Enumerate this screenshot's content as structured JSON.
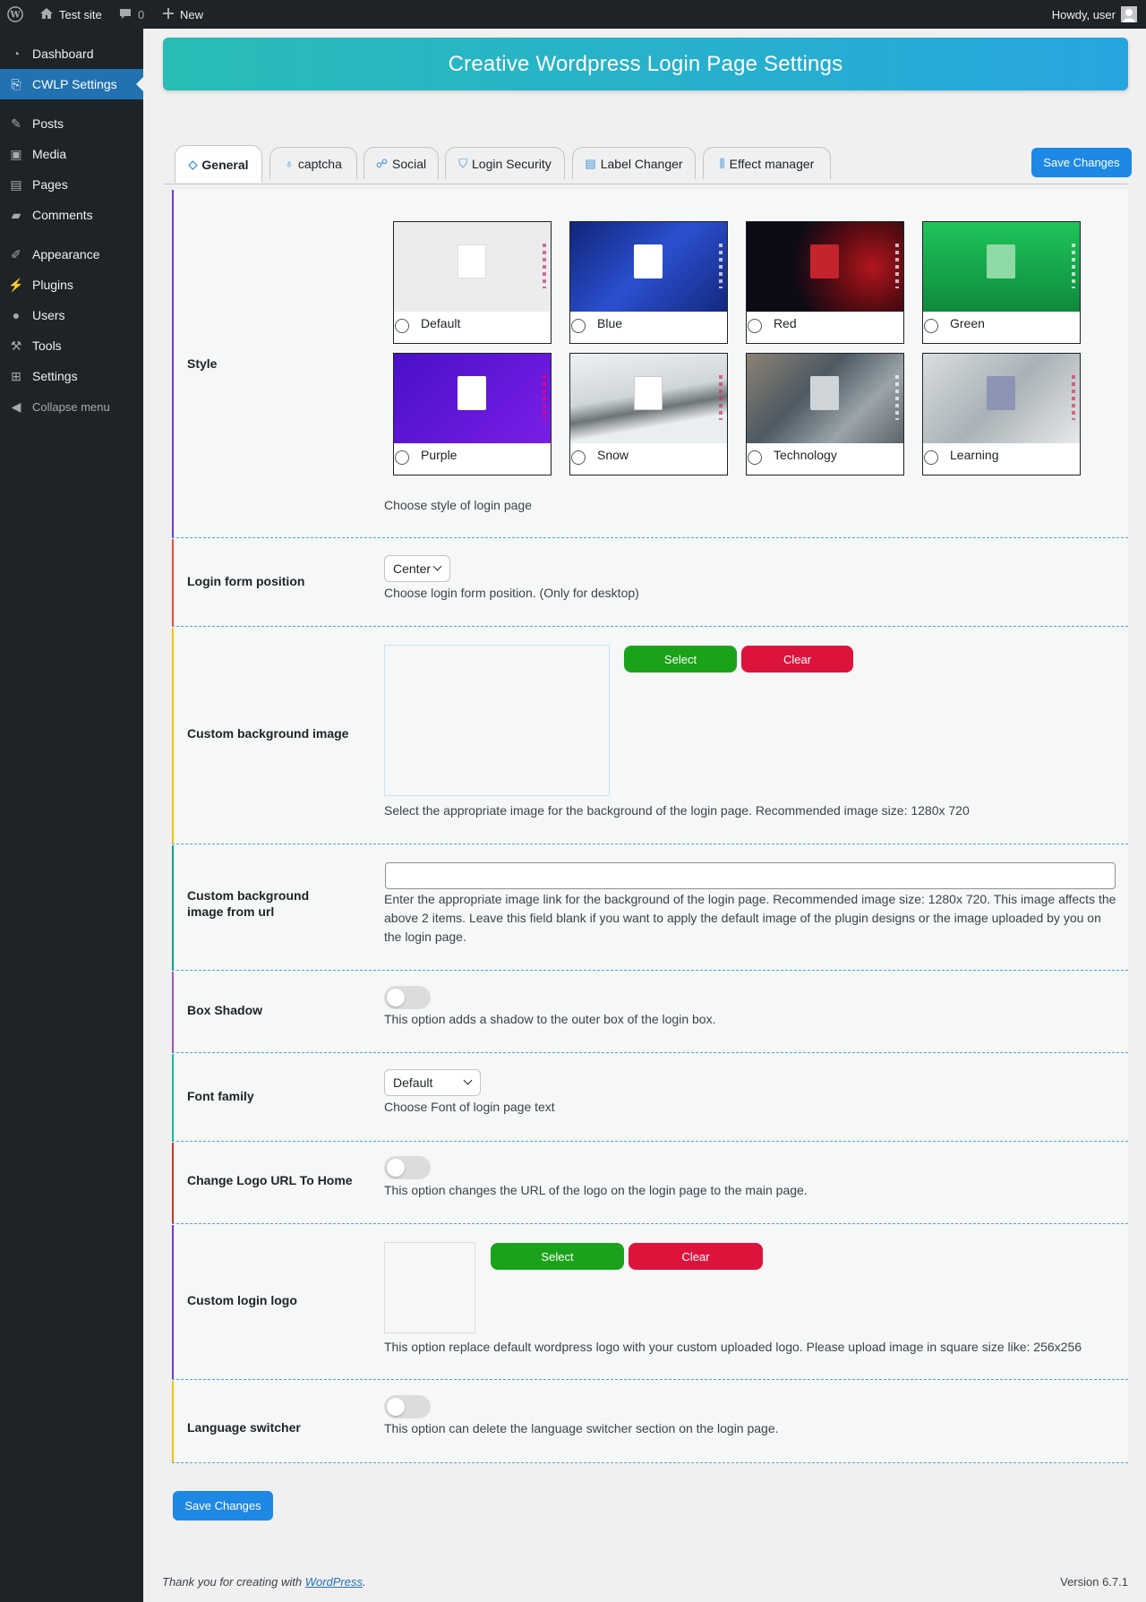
{
  "admin_bar": {
    "site_name": "Test site",
    "comments_count": "0",
    "new_label": "New",
    "howdy": "Howdy, user"
  },
  "sidebar": {
    "items": [
      {
        "label": "Dashboard",
        "icon": "dashboard-icon"
      },
      {
        "label": "CWLP Settings",
        "icon": "cwlp-icon",
        "active": true
      },
      {
        "label": "Posts",
        "icon": "pin-icon"
      },
      {
        "label": "Media",
        "icon": "media-icon"
      },
      {
        "label": "Pages",
        "icon": "pages-icon"
      },
      {
        "label": "Comments",
        "icon": "comment-icon"
      },
      {
        "label": "Appearance",
        "icon": "brush-icon"
      },
      {
        "label": "Plugins",
        "icon": "plug-icon"
      },
      {
        "label": "Users",
        "icon": "user-icon"
      },
      {
        "label": "Tools",
        "icon": "wrench-icon"
      },
      {
        "label": "Settings",
        "icon": "settings-icon"
      },
      {
        "label": "Collapse menu",
        "icon": "collapse-icon"
      }
    ]
  },
  "banner": {
    "title": "Creative Wordpress Login Page Settings"
  },
  "tabs": [
    {
      "label": "General",
      "icon": "general-icon"
    },
    {
      "label": "captcha",
      "icon": "captcha-icon"
    },
    {
      "label": "Social",
      "icon": "social-icon"
    },
    {
      "label": "Login Security",
      "icon": "shield-icon"
    },
    {
      "label": "Label Changer",
      "icon": "label-icon"
    },
    {
      "label": "Effect manager",
      "icon": "effect-icon"
    }
  ],
  "save_label": "Save Changes",
  "style": {
    "label": "Style",
    "options": [
      {
        "name": "Default",
        "bg": "#ececec",
        "form": "#ffffff"
      },
      {
        "name": "Blue",
        "bg": "#1a3aa5",
        "form": "#ffffff"
      },
      {
        "name": "Red",
        "bg": "#160b12",
        "form": "#c4242c"
      },
      {
        "name": "Green",
        "bg": "#17a94d",
        "form": "#8fd9a6"
      },
      {
        "name": "Purple",
        "bg": "#6a12d8",
        "form": "#ffffff"
      },
      {
        "name": "Snow",
        "bg": "#d9dde0",
        "form": "#ffffff"
      },
      {
        "name": "Technology",
        "bg": "#6f7d86",
        "form": "#cfd4d8"
      },
      {
        "name": "Learning",
        "bg": "#c9cfd2",
        "form": "#8c95b5"
      }
    ],
    "description": "Choose style of login page"
  },
  "position": {
    "label": "Login form position",
    "value": "Center",
    "description": "Choose login form position. (Only for desktop)"
  },
  "bg_image": {
    "label": "Custom background image",
    "select": "Select",
    "clear": "Clear",
    "description": "Select the appropriate image for the background of the login page. Recommended image size: 1280x 720"
  },
  "bg_url": {
    "label": "Custom background image from url",
    "value": "",
    "description": "Enter the appropriate image link for the background of the login page. Recommended image size: 1280x 720. This image affects the above 2 items. Leave this field blank if you want to apply the default image of the plugin designs or the image uploaded by you on the login page."
  },
  "box_shadow": {
    "label": "Box Shadow",
    "enabled": false,
    "description": "This option adds a shadow to the outer box of the login box."
  },
  "font_family": {
    "label": "Font family",
    "value": "Default",
    "description": "Choose Font of login page text"
  },
  "logo_url": {
    "label": "Change Logo URL To Home",
    "enabled": false,
    "description": "This option changes the URL of the logo on the login page to the main page."
  },
  "login_logo": {
    "label": "Custom login logo",
    "select": "Select",
    "clear": "Clear",
    "description": "This option replace default wordpress logo with your custom uploaded logo. Please upload image in square size like: 256x256"
  },
  "language_switcher": {
    "label": "Language switcher",
    "enabled": false,
    "description": "This option can delete the language switcher section on the login page."
  },
  "footer": {
    "thanks_prefix": "Thank you for creating with ",
    "thanks_link": "WordPress",
    "thanks_suffix": ".",
    "version": "Version 6.7.1"
  },
  "colors": {
    "accent": "#1e88e5",
    "select_button": "#1aa31a",
    "clear_button": "#dc143c",
    "admin_bg": "#1d2327",
    "active_menu": "#2271b1"
  }
}
